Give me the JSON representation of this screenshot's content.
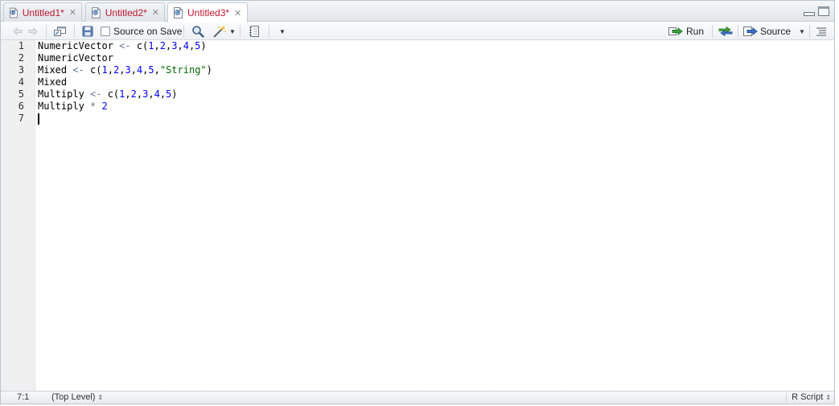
{
  "tabs": [
    {
      "label": "Untitled1*",
      "active": false
    },
    {
      "label": "Untitled2*",
      "active": false
    },
    {
      "label": "Untitled3*",
      "active": true
    }
  ],
  "toolbar": {
    "source_on_save_label": "Source on Save",
    "run_label": "Run",
    "source_label": "Source"
  },
  "editor": {
    "line_numbers": [
      "1",
      "2",
      "3",
      "4",
      "5",
      "6",
      "7"
    ],
    "lines": [
      [
        {
          "t": "NumericVector "
        },
        {
          "t": "<-",
          "c": "op"
        },
        {
          "t": " c("
        },
        {
          "t": "1",
          "c": "num"
        },
        {
          "t": ","
        },
        {
          "t": "2",
          "c": "num"
        },
        {
          "t": ","
        },
        {
          "t": "3",
          "c": "num"
        },
        {
          "t": ","
        },
        {
          "t": "4",
          "c": "num"
        },
        {
          "t": ","
        },
        {
          "t": "5",
          "c": "num"
        },
        {
          "t": ")"
        }
      ],
      [
        {
          "t": "NumericVector"
        }
      ],
      [
        {
          "t": "Mixed "
        },
        {
          "t": "<-",
          "c": "op"
        },
        {
          "t": " c("
        },
        {
          "t": "1",
          "c": "num"
        },
        {
          "t": ","
        },
        {
          "t": "2",
          "c": "num"
        },
        {
          "t": ","
        },
        {
          "t": "3",
          "c": "num"
        },
        {
          "t": ","
        },
        {
          "t": "4",
          "c": "num"
        },
        {
          "t": ","
        },
        {
          "t": "5",
          "c": "num"
        },
        {
          "t": ","
        },
        {
          "t": "\"String\"",
          "c": "str"
        },
        {
          "t": ")"
        }
      ],
      [
        {
          "t": "Mixed"
        }
      ],
      [
        {
          "t": "Multiply "
        },
        {
          "t": "<-",
          "c": "op"
        },
        {
          "t": " c("
        },
        {
          "t": "1",
          "c": "num"
        },
        {
          "t": ","
        },
        {
          "t": "2",
          "c": "num"
        },
        {
          "t": ","
        },
        {
          "t": "3",
          "c": "num"
        },
        {
          "t": ","
        },
        {
          "t": "4",
          "c": "num"
        },
        {
          "t": ","
        },
        {
          "t": "5",
          "c": "num"
        },
        {
          "t": ")"
        }
      ],
      [
        {
          "t": "Multiply "
        },
        {
          "t": "*",
          "c": "op"
        },
        {
          "t": " "
        },
        {
          "t": "2",
          "c": "num"
        }
      ],
      []
    ]
  },
  "statusbar": {
    "position": "7:1",
    "scope": "(Top Level)",
    "file_type": "R Script"
  },
  "colors": {
    "tab_label": "#c0152f",
    "number": "#0000ff",
    "string": "#036a07",
    "operator": "#687687"
  },
  "icons": {
    "tab_doc": "r-document-icon",
    "back": "back-arrow-icon",
    "forward": "forward-arrow-icon",
    "show_in_window": "show-in-new-window-icon",
    "save": "save-icon",
    "find": "search-icon",
    "code_tools": "magic-wand-icon",
    "compile_notebook": "notebook-icon",
    "more": "chevron-down-icon",
    "run": "run-arrow-icon",
    "rerun": "rerun-icon",
    "source": "source-icon",
    "outline": "outline-icon",
    "minimize": "minimize-icon",
    "maximize": "maximize-icon"
  }
}
